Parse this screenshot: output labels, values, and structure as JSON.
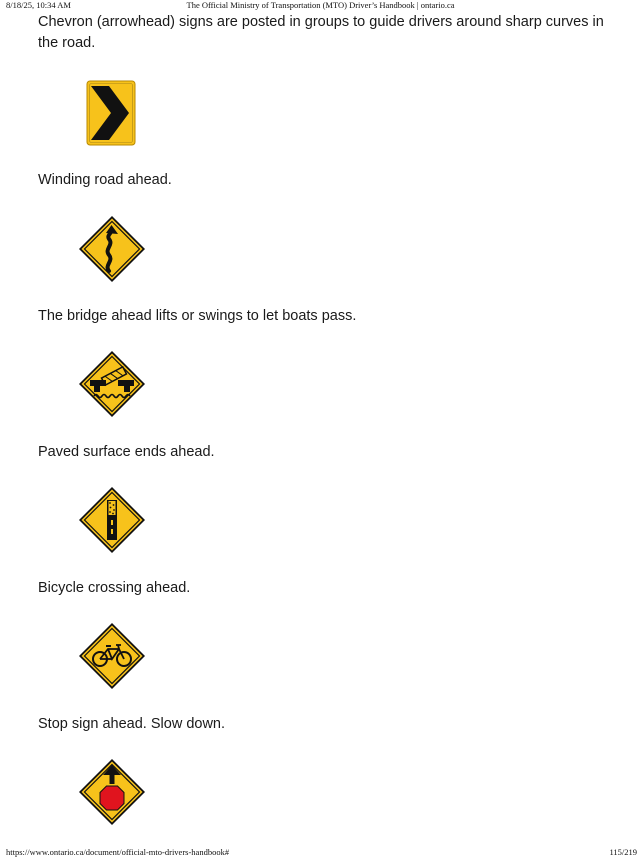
{
  "header": {
    "datetime": "8/18/25, 10:34 AM",
    "title": "The Official Ministry of Transportation (MTO) Driver’s Handbook | ontario.ca"
  },
  "signs": [
    {
      "caption": "Chevron (arrowhead) signs are posted in groups to guide drivers around sharp curves in the road.",
      "icon": "chevron-sign-icon"
    },
    {
      "caption": "Winding road ahead.",
      "icon": "winding-road-sign-icon"
    },
    {
      "caption": "The bridge ahead lifts or swings to let boats pass.",
      "icon": "drawbridge-sign-icon"
    },
    {
      "caption": "Paved surface ends ahead.",
      "icon": "pavement-ends-sign-icon"
    },
    {
      "caption": "Bicycle crossing ahead.",
      "icon": "bicycle-crossing-sign-icon"
    },
    {
      "caption": "Stop sign ahead. Slow down.",
      "icon": "stop-ahead-sign-icon"
    }
  ],
  "colors": {
    "sign_yellow": "#f7c21b",
    "sign_black": "#111111",
    "stop_red": "#e0141e"
  },
  "footer": {
    "url": "https://www.ontario.ca/document/official-mto-drivers-handbook#",
    "page": "115/219"
  }
}
